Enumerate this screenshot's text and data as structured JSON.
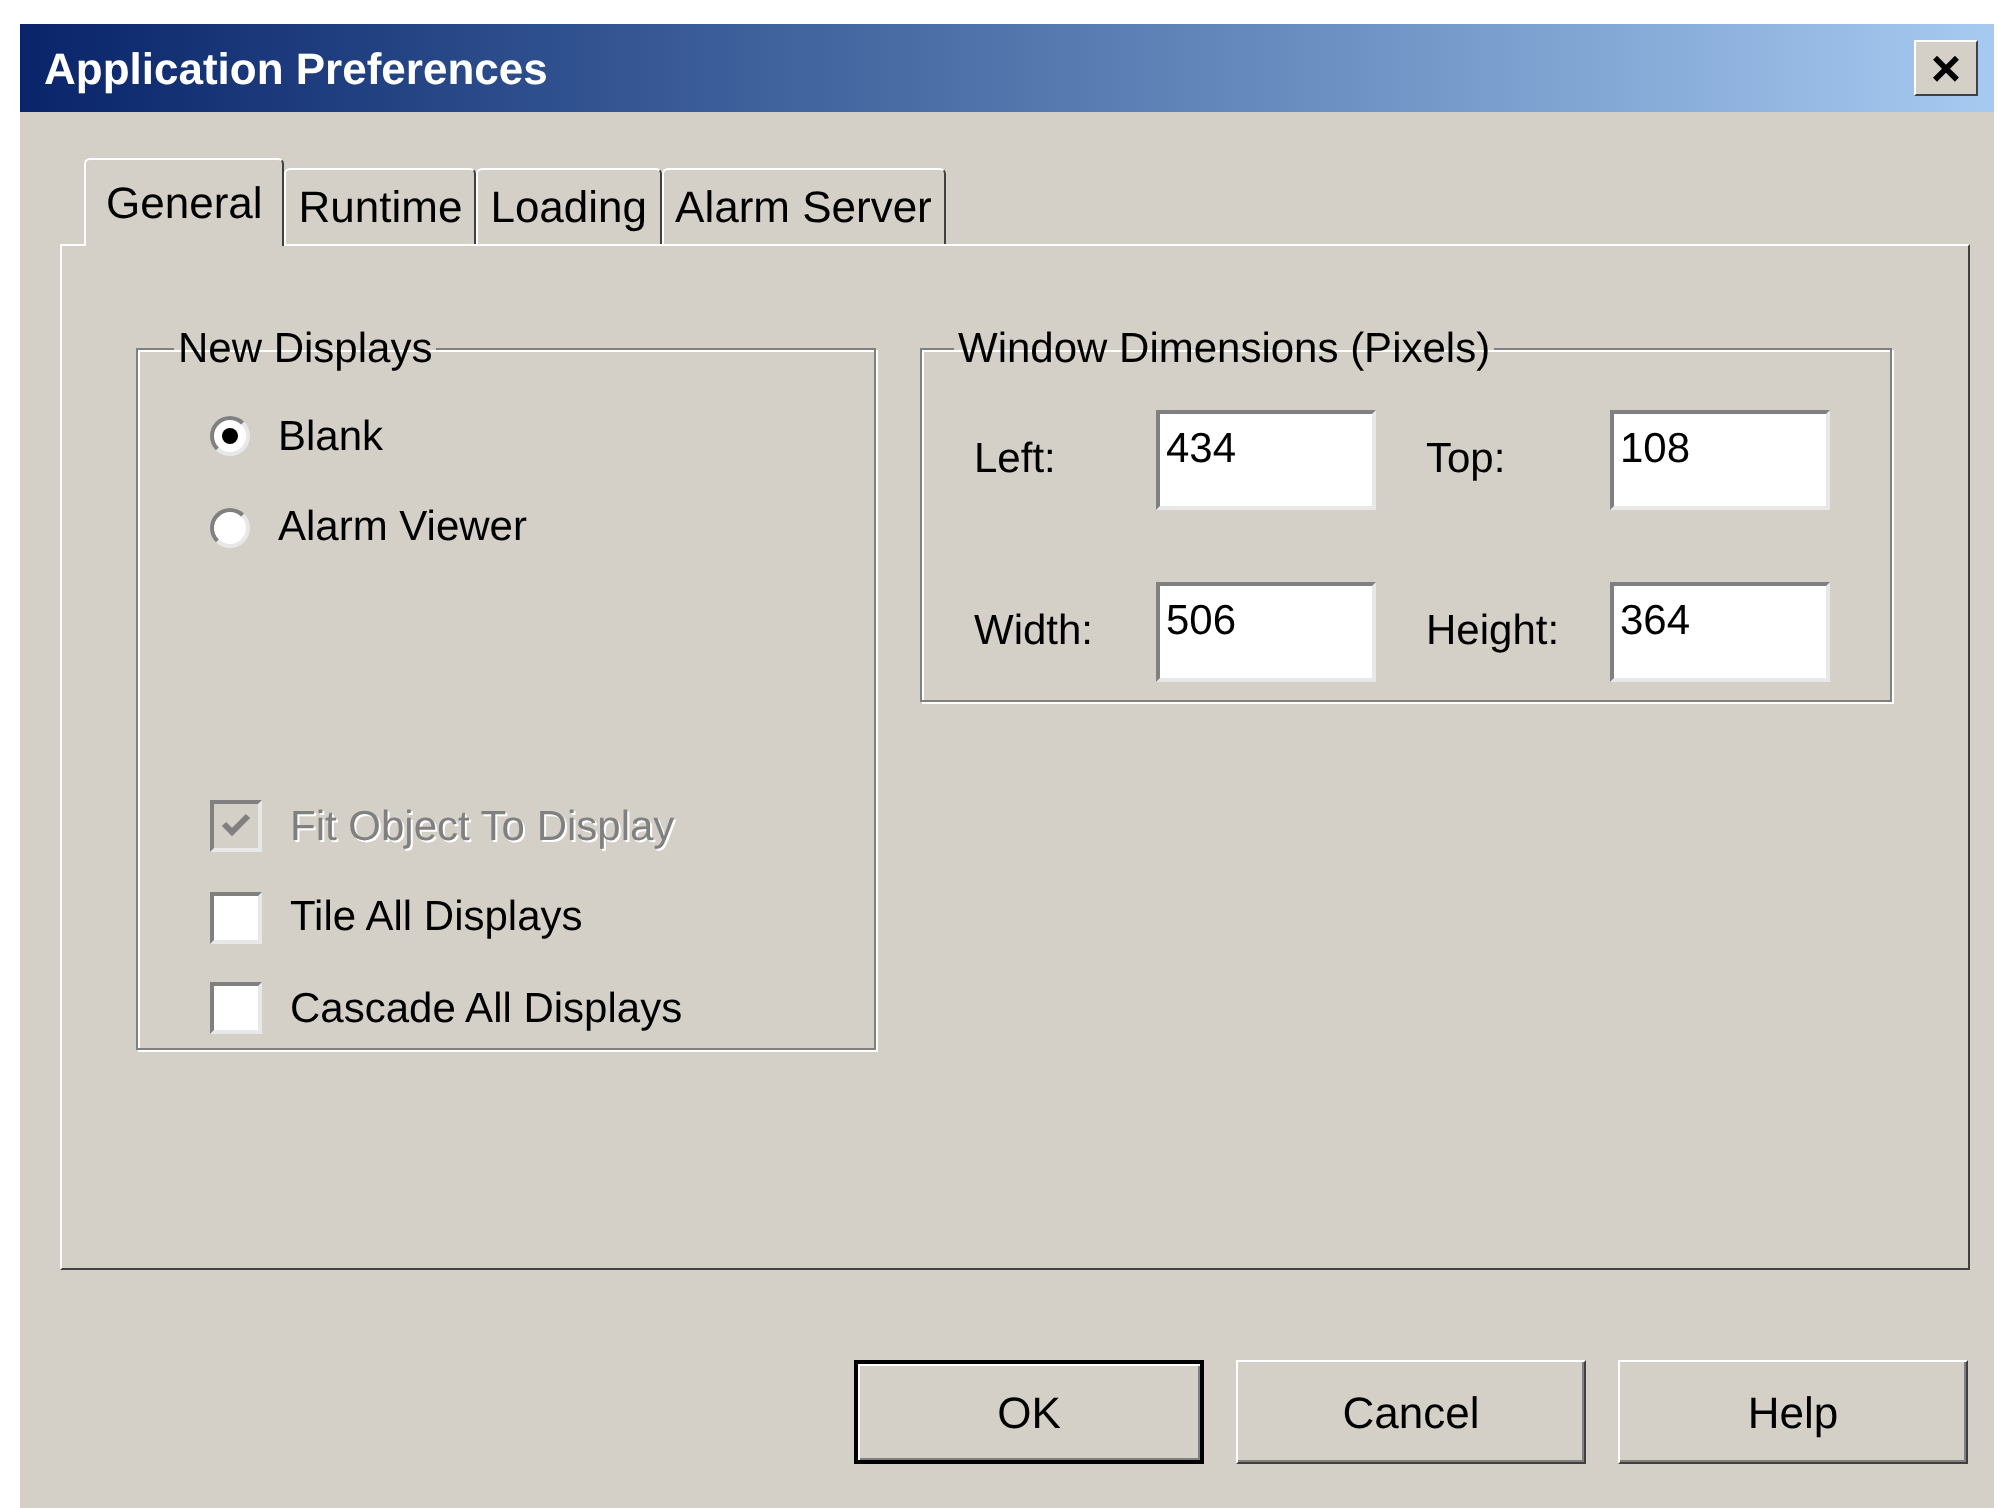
{
  "window": {
    "title": "Application Preferences",
    "close": "×"
  },
  "tabs": [
    {
      "label": "General",
      "selected": true
    },
    {
      "label": "Runtime",
      "selected": false
    },
    {
      "label": "Loading",
      "selected": false
    },
    {
      "label": "Alarm Server",
      "selected": false
    }
  ],
  "new_displays": {
    "title": "New Displays",
    "options": [
      {
        "label": "Blank",
        "selected": true
      },
      {
        "label": "Alarm Viewer",
        "selected": false
      }
    ],
    "checkboxes": [
      {
        "label": "Fit Object To Display",
        "checked": true,
        "disabled": true
      },
      {
        "label": "Tile All Displays",
        "checked": false,
        "disabled": false
      },
      {
        "label": "Cascade All Displays",
        "checked": false,
        "disabled": false
      }
    ]
  },
  "window_dimensions": {
    "title": "Window Dimensions (Pixels)",
    "fields": [
      {
        "label": "Left:",
        "value": "434"
      },
      {
        "label": "Top:",
        "value": "108"
      },
      {
        "label": "Width:",
        "value": "506"
      },
      {
        "label": "Height:",
        "value": "364"
      }
    ]
  },
  "buttons": [
    {
      "label": "OK",
      "default": true
    },
    {
      "label": "Cancel",
      "default": false
    },
    {
      "label": "Help",
      "default": false
    }
  ]
}
